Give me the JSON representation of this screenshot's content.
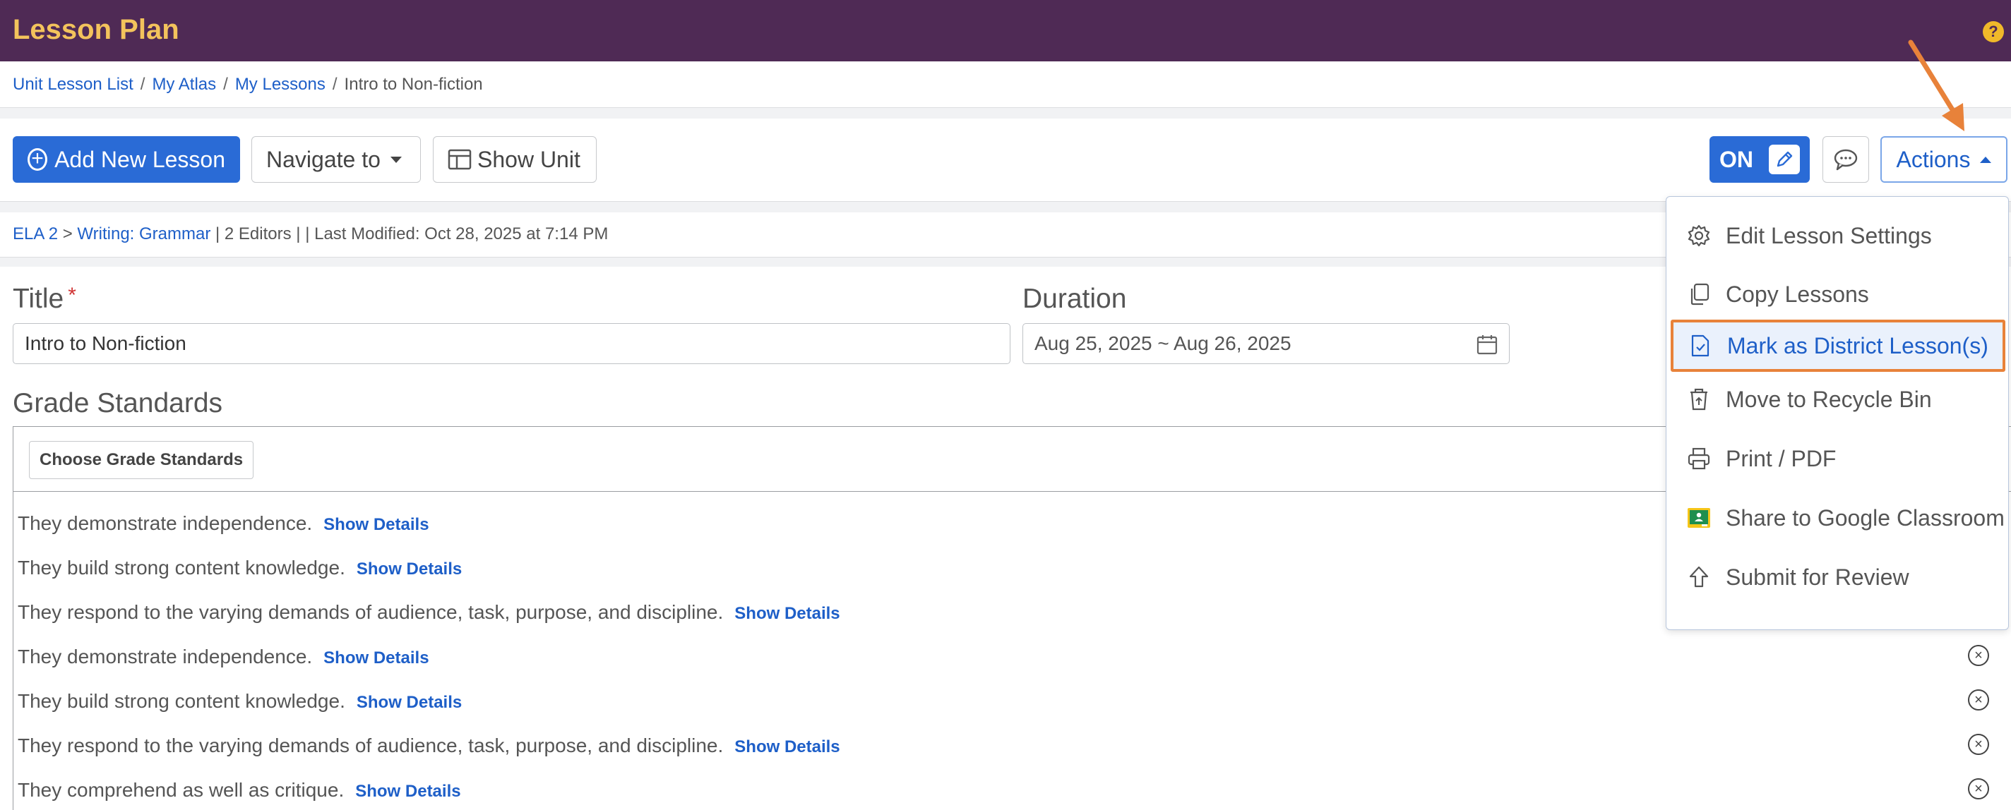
{
  "header": {
    "title": "Lesson Plan",
    "help_label": "?"
  },
  "breadcrumb": {
    "items": [
      {
        "label": "Unit Lesson List"
      },
      {
        "label": "My Atlas"
      },
      {
        "label": "My Lessons"
      }
    ],
    "current": "Intro to Non-fiction",
    "separator": "/"
  },
  "toolbar": {
    "add_lesson": "Add New Lesson",
    "navigate": "Navigate to",
    "show_unit": "Show Unit",
    "toggle": "ON",
    "actions": "Actions"
  },
  "meta": {
    "course": "ELA 2",
    "arrow": ">",
    "topic": "Writing: Grammar",
    "editors": "| 2 Editors |",
    "modified": "| Last Modified: Oct 28, 2025 at 7:14 PM"
  },
  "form": {
    "title_label": "Title",
    "required_mark": "*",
    "title_value": "Intro to Non-fiction",
    "duration_label": "Duration",
    "duration_value": "Aug 25, 2025 ~ Aug 26, 2025"
  },
  "grade_standards": {
    "heading": "Grade Standards",
    "choose_button": "Choose Grade Standards",
    "show_details": "Show Details",
    "remove_symbol": "×",
    "items": [
      "They demonstrate independence.",
      "They build strong content knowledge.",
      "They respond to the varying demands of audience, task, purpose, and discipline.",
      "They demonstrate independence.",
      "They build strong content knowledge.",
      "They respond to the varying demands of audience, task, purpose, and discipline.",
      "They comprehend as well as critique."
    ]
  },
  "actions_menu": {
    "items": [
      {
        "label": "Edit Lesson Settings",
        "icon": "gear-icon"
      },
      {
        "label": "Copy Lessons",
        "icon": "copy-icon"
      },
      {
        "label": "Mark as District Lesson(s)",
        "icon": "document-check-icon",
        "highlighted": true
      },
      {
        "label": "Move to Recycle Bin",
        "icon": "recycle-bin-icon"
      },
      {
        "label": "Print / PDF",
        "icon": "printer-icon"
      },
      {
        "label": "Share to Google Classroom",
        "icon": "google-classroom-icon"
      },
      {
        "label": "Submit for Review",
        "icon": "upload-arrow-icon"
      }
    ]
  },
  "colors": {
    "header_bg": "#4f2a55",
    "header_title": "#f3c35c",
    "primary": "#2a6bd6",
    "link": "#1e5fc8",
    "highlight_border": "#e8823a",
    "annotation_arrow": "#e8823a"
  }
}
